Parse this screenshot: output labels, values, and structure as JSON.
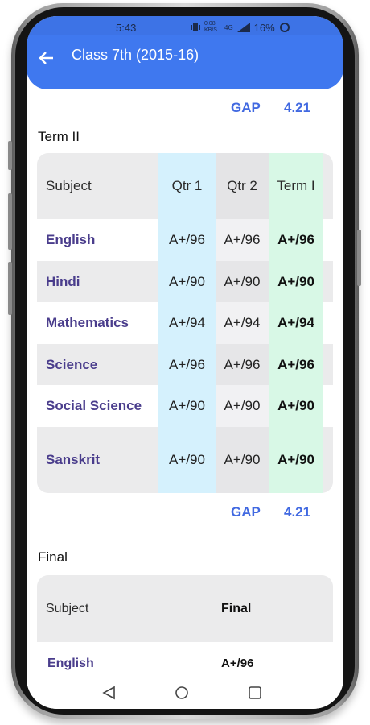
{
  "status_bar": {
    "time": "5:43",
    "net_speed": "0.08 KB/S",
    "network": "4G",
    "battery": "16%"
  },
  "app_bar": {
    "title": "Class 7th (2015-16)",
    "back_icon": "arrow-left-icon"
  },
  "gap_top": {
    "label": "GAP",
    "value": "4.21"
  },
  "term2": {
    "title": "Term II",
    "headers": [
      "Subject",
      "Qtr 1",
      "Qtr 2",
      "Term I"
    ],
    "rows": [
      {
        "subject": "English",
        "qtr1": "A+/96",
        "qtr2": "A+/96",
        "term1": "A+/96"
      },
      {
        "subject": "Hindi",
        "qtr1": "A+/90",
        "qtr2": "A+/90",
        "term1": "A+/90"
      },
      {
        "subject": "Mathematics",
        "qtr1": "A+/94",
        "qtr2": "A+/94",
        "term1": "A+/94"
      },
      {
        "subject": "Science",
        "qtr1": "A+/96",
        "qtr2": "A+/96",
        "term1": "A+/96"
      },
      {
        "subject": "Social Science",
        "qtr1": "A+/90",
        "qtr2": "A+/90",
        "term1": "A+/90"
      },
      {
        "subject": "Sanskrit",
        "qtr1": "A+/90",
        "qtr2": "A+/90",
        "term1": "A+/90"
      }
    ]
  },
  "gap_bottom": {
    "label": "GAP",
    "value": "4.21"
  },
  "final": {
    "title": "Final",
    "headers": [
      "Subject",
      "Final"
    ],
    "rows": [
      {
        "subject": "English",
        "final": "A+/96"
      }
    ]
  },
  "nav_bar": {
    "icons": [
      "back-triangle-icon",
      "home-circle-icon",
      "recents-square-icon"
    ]
  },
  "colors": {
    "accent": "#3f78ef",
    "gap_text": "#4169e1",
    "subject_text": "#4a3d8c",
    "qtr1_column": "#d5f1fd",
    "term1_column": "#d8f8e6"
  }
}
